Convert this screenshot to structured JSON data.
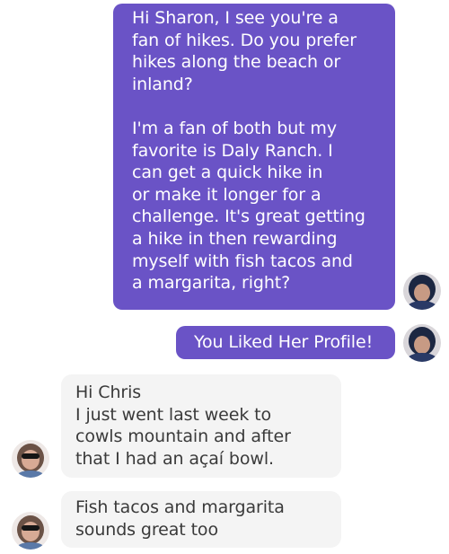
{
  "messages": [
    {
      "from": "me",
      "text": "Hi Sharon, I see you're a\nfan of hikes. Do you prefer\nhikes along the beach or\ninland?\n\nI'm a fan of both but my\nfavorite is Daly Ranch. I\ncan get a quick hike in\nor make it longer for a\nchallenge. It's great getting\na hike in then rewarding\nmyself with fish tacos and\na margarita, right?"
    },
    {
      "from": "me",
      "text": "You Liked Her Profile!"
    },
    {
      "from": "her",
      "text": "Hi Chris\nI just went last week to\ncowls mountain and after\nthat I had an açaí bowl."
    },
    {
      "from": "her",
      "text": "Fish tacos and margarita\nsounds great too"
    }
  ],
  "colors": {
    "outgoing_bubble": "#6a53c6",
    "incoming_bubble": "#f4f4f4",
    "outgoing_text": "#ffffff",
    "incoming_text": "#3a3a3a"
  }
}
